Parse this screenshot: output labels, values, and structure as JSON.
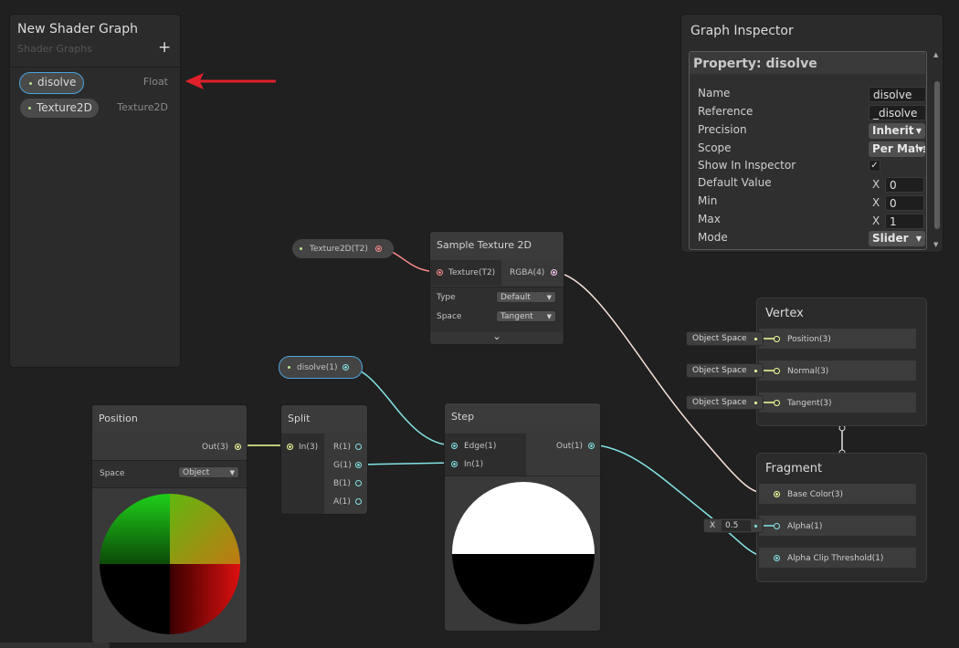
{
  "blackboard": {
    "title": "New Shader Graph",
    "subtitle": "Shader Graphs",
    "add_label": "+",
    "properties": [
      {
        "name": "disolve",
        "type": "Float"
      },
      {
        "name": "Texture2D",
        "type": "Texture2D"
      }
    ]
  },
  "inspector": {
    "title": "Graph Inspector",
    "section": "Property: disolve",
    "labels": {
      "name": "Name",
      "reference": "Reference",
      "precision": "Precision",
      "scope": "Scope",
      "show_in_inspector": "Show In Inspector",
      "default_value": "Default Value",
      "min": "Min",
      "max": "Max",
      "mode": "Mode"
    },
    "values": {
      "name": "disolve",
      "reference": "_disolve",
      "precision": "Inherit",
      "scope": "Per Mate",
      "show_in_inspector": "✓",
      "x_label": "X",
      "default_value": "0",
      "min": "0",
      "max": "1",
      "mode": "Slider"
    }
  },
  "texture_property_node": {
    "label": "Texture2D(T2)"
  },
  "sample_texture": {
    "title": "Sample Texture 2D",
    "input": "Texture(T2)",
    "output": "RGBA(4)",
    "type_label": "Type",
    "type_value": "Default",
    "space_label": "Space",
    "space_value": "Tangent",
    "expand_icon": "⌄"
  },
  "disolve_property_node": {
    "label": "disolve(1)"
  },
  "position_node": {
    "title": "Position",
    "output": "Out(3)",
    "space_label": "Space",
    "space_value": "Object"
  },
  "split_node": {
    "title": "Split",
    "input": "In(3)",
    "outputs": [
      "R(1)",
      "G(1)",
      "B(1)",
      "A(1)"
    ]
  },
  "step_node": {
    "title": "Step",
    "inputs": [
      "Edge(1)",
      "In(1)"
    ],
    "output": "Out(1)"
  },
  "vertex": {
    "title": "Vertex",
    "ports": [
      "Position(3)",
      "Normal(3)",
      "Tangent(3)"
    ],
    "chips": [
      "Object Space",
      "Object Space",
      "Object Space"
    ]
  },
  "fragment": {
    "title": "Fragment",
    "ports": [
      "Base Color(3)",
      "Alpha(1)",
      "Alpha Clip Threshold(1)"
    ],
    "alpha_chip": {
      "x_label": "X",
      "value": "0.5"
    }
  },
  "colors": {
    "background": "#202020",
    "float_wire": "#84e4e7",
    "vec3_wire": "#f6ff9a",
    "vec4_wire": "#fbcbf4",
    "texture_wire": "#ff8b8b",
    "selection": "#4aa3df",
    "annotation_arrow": "#e0202a"
  }
}
